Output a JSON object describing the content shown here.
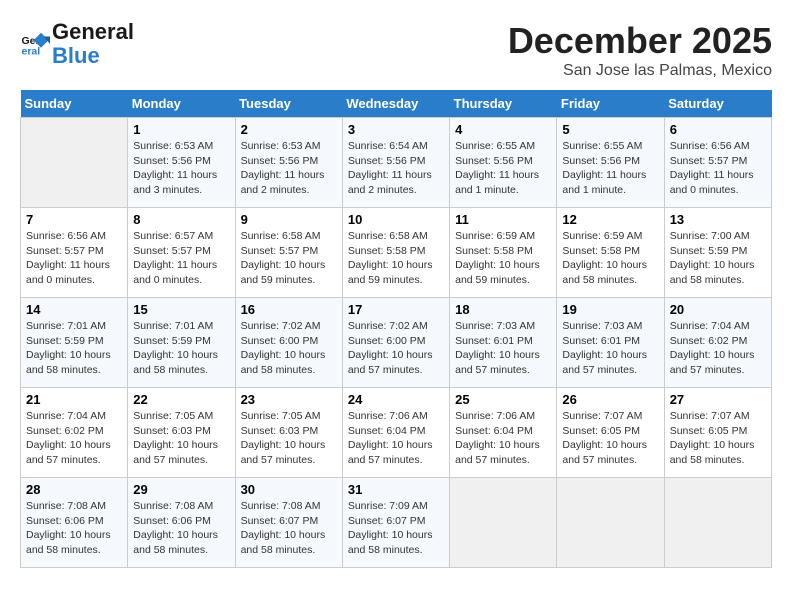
{
  "header": {
    "logo_line1": "General",
    "logo_line2": "Blue",
    "month": "December 2025",
    "location": "San Jose las Palmas, Mexico"
  },
  "weekdays": [
    "Sunday",
    "Monday",
    "Tuesday",
    "Wednesday",
    "Thursday",
    "Friday",
    "Saturday"
  ],
  "weeks": [
    [
      {
        "day": "",
        "info": ""
      },
      {
        "day": "1",
        "info": "Sunrise: 6:53 AM\nSunset: 5:56 PM\nDaylight: 11 hours\nand 3 minutes."
      },
      {
        "day": "2",
        "info": "Sunrise: 6:53 AM\nSunset: 5:56 PM\nDaylight: 11 hours\nand 2 minutes."
      },
      {
        "day": "3",
        "info": "Sunrise: 6:54 AM\nSunset: 5:56 PM\nDaylight: 11 hours\nand 2 minutes."
      },
      {
        "day": "4",
        "info": "Sunrise: 6:55 AM\nSunset: 5:56 PM\nDaylight: 11 hours\nand 1 minute."
      },
      {
        "day": "5",
        "info": "Sunrise: 6:55 AM\nSunset: 5:56 PM\nDaylight: 11 hours\nand 1 minute."
      },
      {
        "day": "6",
        "info": "Sunrise: 6:56 AM\nSunset: 5:57 PM\nDaylight: 11 hours\nand 0 minutes."
      }
    ],
    [
      {
        "day": "7",
        "info": "Sunrise: 6:56 AM\nSunset: 5:57 PM\nDaylight: 11 hours\nand 0 minutes."
      },
      {
        "day": "8",
        "info": "Sunrise: 6:57 AM\nSunset: 5:57 PM\nDaylight: 11 hours\nand 0 minutes."
      },
      {
        "day": "9",
        "info": "Sunrise: 6:58 AM\nSunset: 5:57 PM\nDaylight: 10 hours\nand 59 minutes."
      },
      {
        "day": "10",
        "info": "Sunrise: 6:58 AM\nSunset: 5:58 PM\nDaylight: 10 hours\nand 59 minutes."
      },
      {
        "day": "11",
        "info": "Sunrise: 6:59 AM\nSunset: 5:58 PM\nDaylight: 10 hours\nand 59 minutes."
      },
      {
        "day": "12",
        "info": "Sunrise: 6:59 AM\nSunset: 5:58 PM\nDaylight: 10 hours\nand 58 minutes."
      },
      {
        "day": "13",
        "info": "Sunrise: 7:00 AM\nSunset: 5:59 PM\nDaylight: 10 hours\nand 58 minutes."
      }
    ],
    [
      {
        "day": "14",
        "info": "Sunrise: 7:01 AM\nSunset: 5:59 PM\nDaylight: 10 hours\nand 58 minutes."
      },
      {
        "day": "15",
        "info": "Sunrise: 7:01 AM\nSunset: 5:59 PM\nDaylight: 10 hours\nand 58 minutes."
      },
      {
        "day": "16",
        "info": "Sunrise: 7:02 AM\nSunset: 6:00 PM\nDaylight: 10 hours\nand 58 minutes."
      },
      {
        "day": "17",
        "info": "Sunrise: 7:02 AM\nSunset: 6:00 PM\nDaylight: 10 hours\nand 57 minutes."
      },
      {
        "day": "18",
        "info": "Sunrise: 7:03 AM\nSunset: 6:01 PM\nDaylight: 10 hours\nand 57 minutes."
      },
      {
        "day": "19",
        "info": "Sunrise: 7:03 AM\nSunset: 6:01 PM\nDaylight: 10 hours\nand 57 minutes."
      },
      {
        "day": "20",
        "info": "Sunrise: 7:04 AM\nSunset: 6:02 PM\nDaylight: 10 hours\nand 57 minutes."
      }
    ],
    [
      {
        "day": "21",
        "info": "Sunrise: 7:04 AM\nSunset: 6:02 PM\nDaylight: 10 hours\nand 57 minutes."
      },
      {
        "day": "22",
        "info": "Sunrise: 7:05 AM\nSunset: 6:03 PM\nDaylight: 10 hours\nand 57 minutes."
      },
      {
        "day": "23",
        "info": "Sunrise: 7:05 AM\nSunset: 6:03 PM\nDaylight: 10 hours\nand 57 minutes."
      },
      {
        "day": "24",
        "info": "Sunrise: 7:06 AM\nSunset: 6:04 PM\nDaylight: 10 hours\nand 57 minutes."
      },
      {
        "day": "25",
        "info": "Sunrise: 7:06 AM\nSunset: 6:04 PM\nDaylight: 10 hours\nand 57 minutes."
      },
      {
        "day": "26",
        "info": "Sunrise: 7:07 AM\nSunset: 6:05 PM\nDaylight: 10 hours\nand 57 minutes."
      },
      {
        "day": "27",
        "info": "Sunrise: 7:07 AM\nSunset: 6:05 PM\nDaylight: 10 hours\nand 58 minutes."
      }
    ],
    [
      {
        "day": "28",
        "info": "Sunrise: 7:08 AM\nSunset: 6:06 PM\nDaylight: 10 hours\nand 58 minutes."
      },
      {
        "day": "29",
        "info": "Sunrise: 7:08 AM\nSunset: 6:06 PM\nDaylight: 10 hours\nand 58 minutes."
      },
      {
        "day": "30",
        "info": "Sunrise: 7:08 AM\nSunset: 6:07 PM\nDaylight: 10 hours\nand 58 minutes."
      },
      {
        "day": "31",
        "info": "Sunrise: 7:09 AM\nSunset: 6:07 PM\nDaylight: 10 hours\nand 58 minutes."
      },
      {
        "day": "",
        "info": ""
      },
      {
        "day": "",
        "info": ""
      },
      {
        "day": "",
        "info": ""
      }
    ]
  ]
}
